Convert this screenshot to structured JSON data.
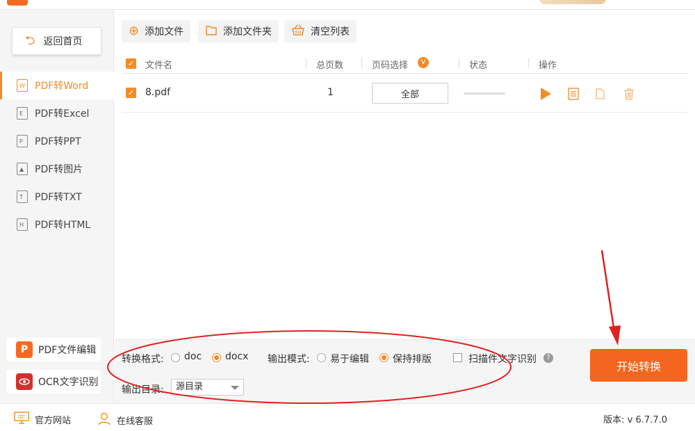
{
  "sidebar": {
    "home_label": "返回首页",
    "items": [
      {
        "label": "PDF转Word",
        "icon": "W"
      },
      {
        "label": "PDF转Excel",
        "icon": "E"
      },
      {
        "label": "PDF转PPT",
        "icon": "P"
      },
      {
        "label": "PDF转图片",
        "icon": "▲"
      },
      {
        "label": "PDF转TXT",
        "icon": "T"
      },
      {
        "label": "PDF转HTML",
        "icon": "H"
      }
    ],
    "tools": [
      {
        "label": "PDF文件编辑",
        "icon": "pdf-edit-icon"
      },
      {
        "label": "OCR文字识别",
        "icon": "eye-icon"
      }
    ]
  },
  "toolbar": {
    "add_file": "添加文件",
    "add_folder": "添加文件夹",
    "clear_list": "清空列表"
  },
  "table": {
    "headers": {
      "filename": "文件名",
      "pages": "总页数",
      "page_select": "页码选择",
      "status": "状态",
      "actions": "操作"
    },
    "rows": [
      {
        "filename": "8.pdf",
        "pages": "1",
        "page_select": "全部"
      }
    ]
  },
  "options": {
    "format_label": "转换格式:",
    "formats": [
      "doc",
      "docx"
    ],
    "format_selected": "docx",
    "mode_label": "输出模式:",
    "modes": [
      "易于编辑",
      "保持排版"
    ],
    "mode_selected": "保持排版",
    "ocr_label": "扫描件文字识别",
    "dir_label": "输出目录:",
    "dir_value": "源目录"
  },
  "start_button": "开始转换",
  "footer": {
    "website": "官方网站",
    "support": "在线客服",
    "version": "版本: v 6.7.7.0"
  },
  "colors": {
    "accent": "#f28c28",
    "start": "#f4661f",
    "annotation": "#e02020"
  }
}
